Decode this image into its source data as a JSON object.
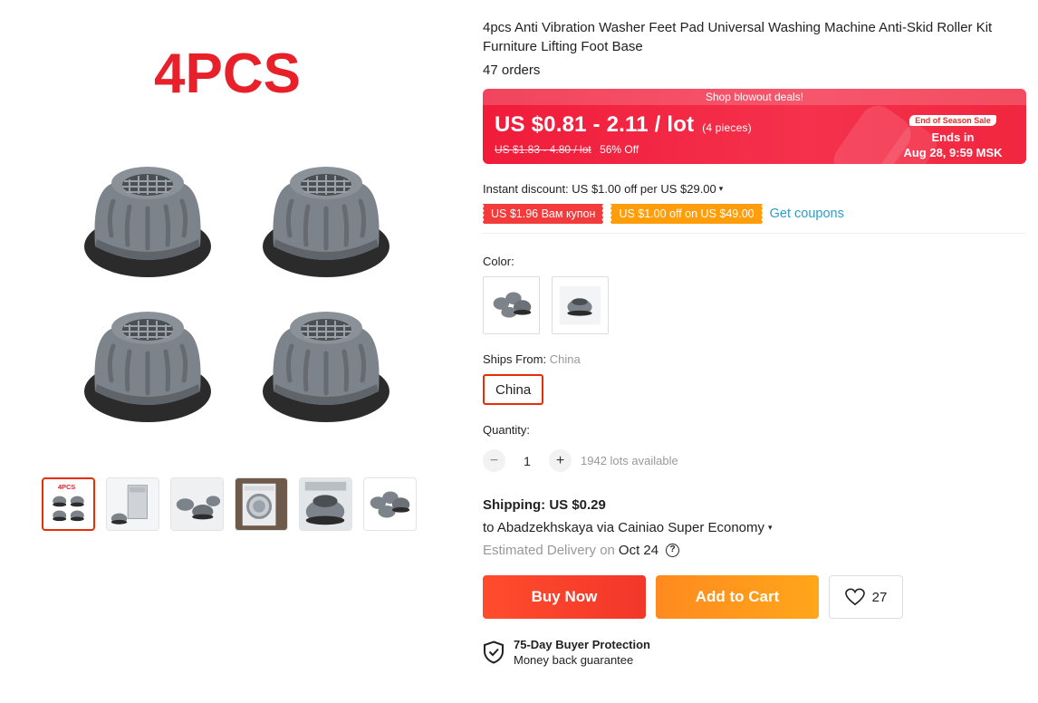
{
  "gallery": {
    "main_overlay_text": "4PCS",
    "thumbnail_overlay_text": "4PCS",
    "thumbnails": [
      "thumb-1",
      "thumb-2",
      "thumb-3",
      "thumb-4",
      "thumb-5",
      "thumb-6"
    ],
    "active_thumbnail": 0
  },
  "product": {
    "title": "4pcs Anti Vibration Washer Feet Pad Universal Washing Machine Anti-Skid Roller Kit Furniture Lifting Foot Base",
    "orders": "47 orders"
  },
  "deal": {
    "banner_label": "Shop blowout deals!",
    "price": "US $0.81 - 2.11 / lot",
    "price_unit": "(4 pieces)",
    "original_price": "US $1.83 - 4.80 / lot",
    "discount": "56% Off",
    "season_badge": "End of Season Sale",
    "ends_in_label": "Ends in",
    "ends_at": "Aug 28, 9:59 MSK"
  },
  "discounts": {
    "instant": "Instant discount: US $1.00 off per US $29.00",
    "coupon_1": "US $1.96 Вам купон",
    "coupon_2": "US $1.00 off on US $49.00",
    "get_coupons": "Get coupons"
  },
  "options": {
    "color_label": "Color:",
    "ships_from_label": "Ships From:",
    "ships_from_value": "China",
    "ships_from_option": "China",
    "quantity_label": "Quantity:",
    "quantity_value": "1",
    "minus": "−",
    "plus": "+",
    "available": "1942 lots available"
  },
  "shipping": {
    "cost": "Shipping: US $0.29",
    "route": "to Abadzekhskaya via Cainiao Super Economy",
    "estimated_label": "Estimated Delivery on",
    "estimated_date": "Oct 24",
    "help": "?"
  },
  "actions": {
    "buy_now": "Buy Now",
    "add_to_cart": "Add to Cart",
    "wishlist_count": "27"
  },
  "protection": {
    "title": "75-Day Buyer Protection",
    "subtitle": "Money back guarantee"
  },
  "colors": {
    "accent_red": "#e62e04",
    "deal_red": "#f01c3a",
    "coupon_orange": "#ff9d0a",
    "link_blue": "#2e9cc4"
  }
}
